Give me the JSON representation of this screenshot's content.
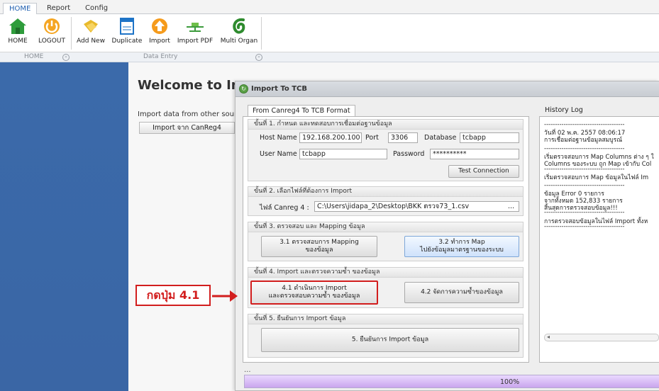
{
  "ribbon": {
    "tabs": [
      "HOME",
      "Report",
      "Config"
    ],
    "buttons": [
      "HOME",
      "LOGOUT",
      "Add New",
      "Duplicate",
      "Import",
      "Import PDF",
      "Multi Organ"
    ],
    "group_home": "HOME",
    "group_data_entry": "Data Entry"
  },
  "main": {
    "welcome": "Welcome to Im",
    "import_from_label": "Import data from other source",
    "canreg_button": "Import จาก CanReg4"
  },
  "dialog": {
    "title": "Import To TCB",
    "tab": "From Canreg4 To TCB Format",
    "step1": {
      "header": "ขั้นที่ 1. กำหนด และทดสอบการเชื่อมต่อฐานข้อมูล",
      "host_label": "Host Name",
      "host_value": "192.168.200.100",
      "port_label": "Port",
      "port_value": "3306",
      "database_label": "Database",
      "database_value": "tcbapp",
      "user_label": "User Name",
      "user_value": "tcbapp",
      "password_label": "Password",
      "password_value": "**********",
      "test_button": "Test Connection"
    },
    "step2": {
      "header": "ขั้นที่ 2. เลือกไฟล์ที่ต้องการ Import",
      "file_label": "ไฟล์ Canreg 4 :",
      "file_value": "C:\\Users\\jidapa_2\\Desktop\\BKK ตรวจ73_1.csv",
      "browse": "..."
    },
    "step3": {
      "header": "ขั้นที่ 3. ตรวจสอบ และ Mapping ข้อมูล",
      "btn1_line1": "3.1 ตรวจสอบการ Mapping",
      "btn1_line2": "ของข้อมูล",
      "btn2_line1": "3.2 ทำการ Map",
      "btn2_line2": "ไปยังข้อมูลมาตรฐานของระบบ"
    },
    "step4": {
      "header": "ขั้นที่ 4. Import และตรวจความซ้ำ ของข้อมูล",
      "btn1_line1": "4.1 ดำเนินการ Import",
      "btn1_line2": "และตรวจสอบความซ้ำ ของข้อมูล",
      "btn2": "4.2 จัดการความซ้ำของข้อมูล"
    },
    "step5": {
      "header": "ขั้นที่ 5. ยืนยันการ Import ข้อมูล",
      "btn": "5. ยืนยันการ Import ข้อมูล"
    },
    "history": {
      "title": "History Log",
      "lines": [
        "-------------------------------------",
        "วันที่ 02 พ.ค. 2557 08:06:17",
        "การเชื่อมต่อฐานข้อมูลสมบูรณ์",
        "-------------------------------------",
        "เริ่มตรวจสอบการ Map Columns ต่าง ๆ ใ",
        "Columns ของระบบ ถูก Map เข้ากับ Col",
        "-------------------------------------",
        "เริ่มตรวจสอบการ Map ข้อมูลในไฟล์ Im",
        "-------------------------------------",
        "ข้อมูล Error        0 รายการ",
        "จากทั้งหมด        152,833 รายการ",
        "สิ้นสุดการตรวจสอบข้อมูล!!!",
        "-------------------------------------",
        "การตรวจสอบข้อมูลในไฟล์ Import ทั้งห",
        "-------------------------------------"
      ]
    },
    "status_dots": "...",
    "progress_value": 100,
    "progress_label": "100%"
  },
  "callout": "กดปุ่ม 4.1",
  "colors": {
    "accent_red": "#d21e1e",
    "side_panel": "#3b6aaa",
    "progress": "#c9a5ee"
  }
}
